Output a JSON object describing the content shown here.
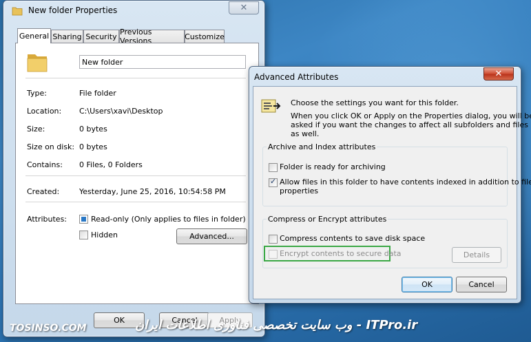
{
  "props_window": {
    "title": "New folder Properties",
    "tabs": [
      "General",
      "Sharing",
      "Security",
      "Previous Versions",
      "Customize"
    ],
    "folder_name": "New folder",
    "rows": [
      {
        "label": "Type:",
        "value": "File folder"
      },
      {
        "label": "Location:",
        "value": "C:\\Users\\xavi\\Desktop"
      },
      {
        "label": "Size:",
        "value": "0 bytes"
      },
      {
        "label": "Size on disk:",
        "value": "0 bytes"
      },
      {
        "label": "Contains:",
        "value": "0 Files, 0 Folders"
      },
      {
        "label": "Created:",
        "value": "Yesterday, June 25, 2016, 10:54:58 PM"
      }
    ],
    "attributes_label": "Attributes:",
    "readonly_label": "Read-only (Only applies to files in folder)",
    "hidden_label": "Hidden",
    "advanced_button": "Advanced...",
    "ok_button": "OK",
    "cancel_button": "Cancel",
    "apply_button": "Apply"
  },
  "adv_window": {
    "title": "Advanced Attributes",
    "intro": "Choose the settings you want for this folder.",
    "desc_lines": [
      "When you click OK or Apply on the Properties dialog, you will be",
      "asked if you want the changes to affect all subfolders and files",
      "as well."
    ],
    "archive_group": "Archive and Index attributes",
    "archive_label": "Folder is ready for archiving",
    "index_lines": [
      "Allow files in this folder to have contents indexed in addition to file",
      "properties"
    ],
    "compress_group": "Compress or Encrypt attributes",
    "compress_label": "Compress contents to save disk space",
    "encrypt_label": "Encrypt contents to secure data",
    "details_button": "Details",
    "ok_button": "OK",
    "cancel_button": "Cancel"
  },
  "watermark": {
    "left": "TOSINSO.COM",
    "right": "وب سایت تخصصی فناوری اطلاعات ایران - ITPro.ir"
  },
  "colors": {
    "highlight_box": "#3aa845",
    "close_red": "#cf4a2f"
  }
}
